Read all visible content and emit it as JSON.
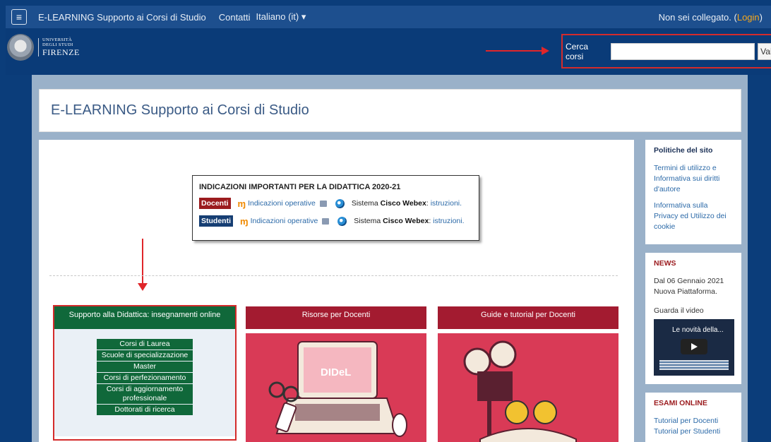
{
  "navbar": {
    "menu_icon": "hamburger-icon",
    "site_name": "E-LEARNING Supporto ai Corsi di Studio",
    "contacts": "Contatti",
    "language": "Italiano (it)",
    "status_prefix": "Non sei collegato. (",
    "login": "Login",
    "status_suffix": ")"
  },
  "header": {
    "logo_line1": "UNIVERSITÀ",
    "logo_line2": "DEGLI STUDI",
    "logo_line3": "FIRENZE",
    "search_label": "Cerca corsi",
    "search_value": "",
    "search_button": "Vai"
  },
  "title": "E-LEARNING Supporto ai Corsi di Studio",
  "notice": {
    "title": "INDICAZIONI IMPORTANTI PER LA DIDATTICA 2020-21",
    "rows": [
      {
        "tag": "Docenti",
        "link": "Indicazioni operative",
        "sys_prefix": "Sistema",
        "sys_bold": "Cisco Webex",
        "colon": ":",
        "instr": "istruzioni",
        "dot": "."
      },
      {
        "tag": "Studenti",
        "link": "Indicazioni operative",
        "sys_prefix": "Sistema",
        "sys_bold": "Cisco Webex",
        "colon": ":",
        "instr": "istruzioni",
        "dot": "."
      }
    ]
  },
  "columns": [
    {
      "title": "Supporto alla Didattica: insegnamenti online",
      "items": [
        "Corsi di Laurea",
        "Scuole di specializzazione",
        "Master",
        "Corsi di perfezionamento",
        "Corsi di aggiornamento professionale",
        "Dottorati di ricerca"
      ]
    },
    {
      "title": "Risorse per Docenti",
      "image_text": "DIDeL"
    },
    {
      "title": "Guide e tutorial per Docenti"
    }
  ],
  "sidebar": {
    "policies": {
      "title": "Politiche del sito",
      "links": [
        "Termini di utilizzo e Informativa sui diritti d'autore",
        "Informativa sulla Privacy ed Utilizzo dei cookie"
      ]
    },
    "news": {
      "title": "NEWS",
      "text1": "Dal 06 Gennaio 2021",
      "text2": "Nuova Piattaforma.",
      "text3": "Guarda il video",
      "video_title": "Le novità della..."
    },
    "exams": {
      "title": "ESAMI ONLINE",
      "links": [
        "Tutorial per Docenti",
        "Tutorial per Studenti"
      ]
    }
  },
  "colors": {
    "navy": "#0b3d7a",
    "green": "#10683a",
    "crimson": "#a31b30",
    "highlight": "#d42b2b"
  }
}
